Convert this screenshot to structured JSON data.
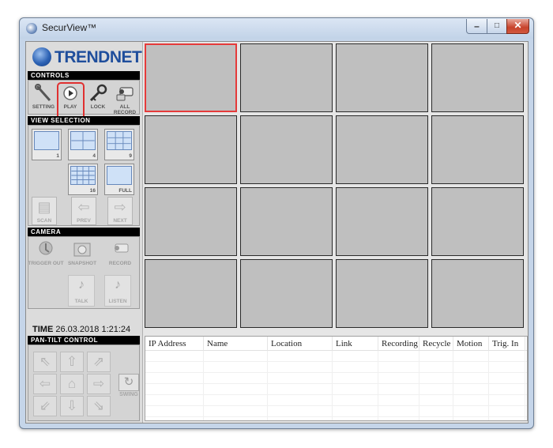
{
  "window": {
    "title": "SecurView™",
    "minimize": "–",
    "maximize": "□",
    "close": "✕"
  },
  "logo": {
    "text": "TRENDNET"
  },
  "controls": {
    "header": "CONTROLS",
    "items": [
      {
        "label": "SETTING",
        "icon": "wrench-icon"
      },
      {
        "label": "PLAY",
        "icon": "play-icon"
      },
      {
        "label": "LOCK",
        "icon": "key-icon"
      },
      {
        "label": "ALL RECORD",
        "icon": "camera-record-icon"
      }
    ]
  },
  "view_selection": {
    "header": "VIEW SELECTION",
    "layouts": [
      "1",
      "4",
      "9",
      "16",
      "FULL"
    ],
    "nav": [
      {
        "label": "SCAN",
        "glyph": "▤"
      },
      {
        "label": "PREV",
        "glyph": "⇦"
      },
      {
        "label": "NEXT",
        "glyph": "⇨"
      }
    ]
  },
  "camera": {
    "header": "CAMERA",
    "items": [
      {
        "label": "TRIGGER OUT",
        "icon": "trigger-icon"
      },
      {
        "label": "SNAPSHOT",
        "icon": "snapshot-icon"
      },
      {
        "label": "RECORD",
        "icon": "camera-record-icon"
      }
    ],
    "audio": [
      {
        "label": "TALK",
        "glyph": "♪"
      },
      {
        "label": "LISTEN",
        "glyph": "♪"
      }
    ]
  },
  "time": {
    "label": "TIME",
    "value": "26.03.2018 1:21:24"
  },
  "ptz": {
    "header": "PAN-TILT CONTROL",
    "buttons": [
      "⇖",
      "⇧",
      "⇗",
      "⇦",
      "⌂",
      "⇨",
      "⇙",
      "⇩",
      "⇘"
    ],
    "swing_label": "SWING",
    "swing_glyph": "↻"
  },
  "video_grid": {
    "rows": 4,
    "cols": 4,
    "selected_cell": 1
  },
  "table": {
    "columns": [
      "IP Address",
      "Name",
      "Location",
      "Link",
      "Recording",
      "Recycle",
      "Motion",
      "Trig. In"
    ],
    "rows": []
  },
  "colors": {
    "accent_selected": "#e53a3a",
    "cell_bg": "#bfbfbf",
    "panel_bg": "#dcdcdc",
    "title_bar": "#c5d5e9"
  }
}
